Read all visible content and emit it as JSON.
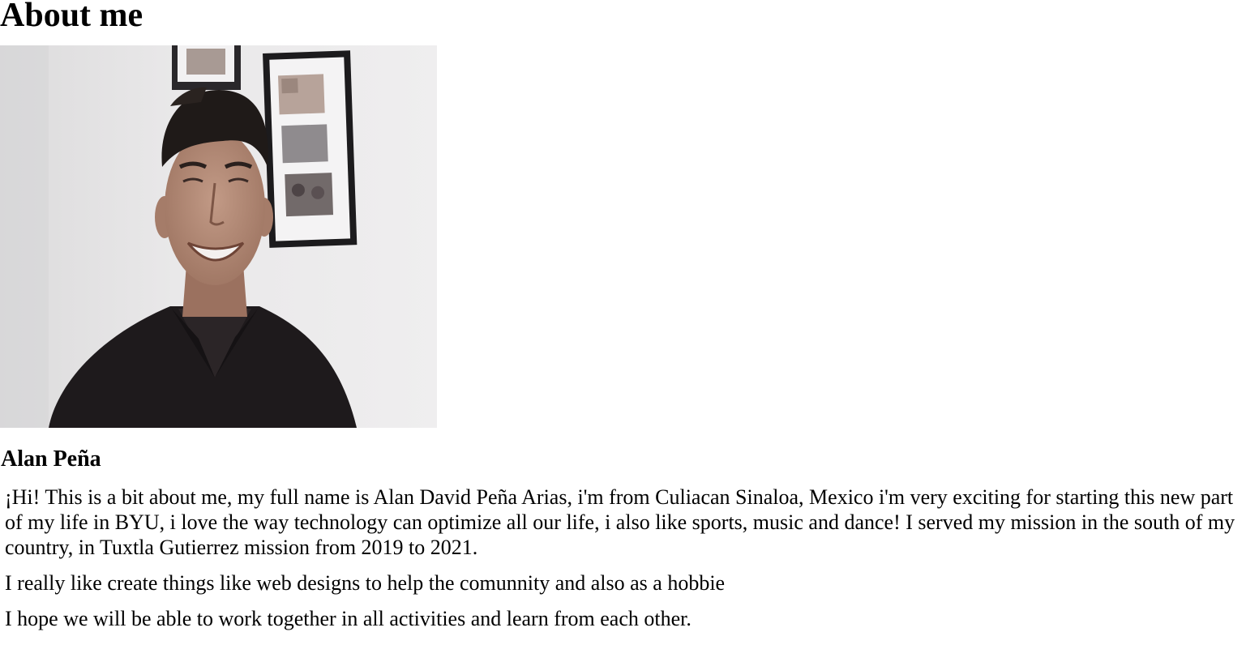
{
  "page": {
    "heading": "About me",
    "name": "Alan Peña",
    "paragraphs": [
      "¡Hi! This is a bit about me, my full name is Alan David Peña Arias, i'm from Culiacan Sinaloa, Mexico i'm very exciting for starting this new part of my life in BYU, i love the way technology can optimize all our life, i also like sports, music and dance! I served my mission in the south of my country, in Tuxtla Gutierrez mission from 2019 to 2021.",
      "I really like create things like web designs to help the comunnity and also as a hobbie",
      "I hope we will be able to work together in all activities and learn from each other."
    ]
  },
  "colors": {
    "background": "#ffffff",
    "text": "#000000",
    "photo_wall": "#e6e5e6",
    "shirt": "#1e1a1c",
    "skin": "#b08a76",
    "hair": "#1f1a18",
    "frame": "#1b1a1c"
  }
}
